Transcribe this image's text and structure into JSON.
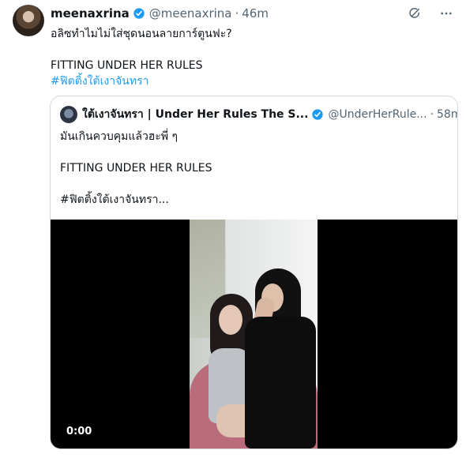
{
  "tweet": {
    "author": {
      "name": "meenaxrina",
      "handle": "@meenaxrina",
      "time": "46m"
    },
    "text": {
      "line1": "อลิซทำไมไม่ใส่ชุดนอนลายการ์ตูนฟะ?",
      "line2": "FITTING UNDER HER RULES",
      "hashtag": "#ฟิตติ้งใต้เงาจันทรา"
    },
    "icons": {
      "grok": "grok-icon",
      "more": "more-icon",
      "verified": "verified-icon"
    }
  },
  "quote": {
    "author": {
      "name": "ใต้เงาจันทรา | Under Her Rules The S...",
      "handle": "@UnderHerRule...",
      "time": "58m"
    },
    "text": {
      "line1": "มันเกินควบคุมแล้วฮะพี่ ๆ",
      "line2": "FITTING UNDER HER RULES",
      "line3": "#ฟิตติ้งใต้เงาจันทรา..."
    },
    "video": {
      "timestamp": "0:00"
    }
  },
  "colors": {
    "accent": "#1d9bf0",
    "text": "#0f1419",
    "secondary": "#536471",
    "border": "#cfd9de",
    "video_bg": "#000000"
  }
}
